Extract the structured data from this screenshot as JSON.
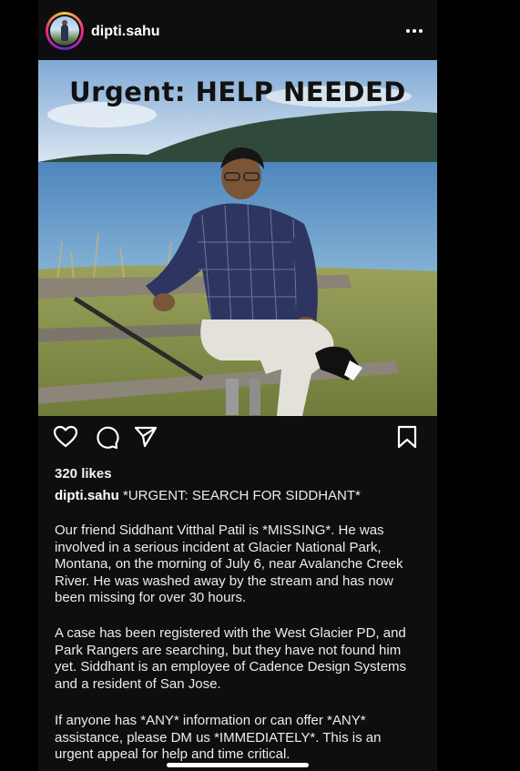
{
  "header": {
    "username": "dipti.sahu",
    "avatar_icon": "profile-avatar",
    "more_icon": "more-horizontal-icon"
  },
  "image": {
    "overlay_text": "Urgent: HELP NEEDED"
  },
  "actions": {
    "like_icon": "heart-icon",
    "comment_icon": "comment-icon",
    "share_icon": "send-icon",
    "save_icon": "bookmark-icon"
  },
  "likes": "320 likes",
  "caption": {
    "username": "dipti.sahu",
    "headline": "*URGENT: SEARCH FOR SIDDHANT*",
    "paragraphs": [
      "Our friend Siddhant Vitthal Patil is *MISSING*. He was involved in a serious incident at Glacier National Park, Montana, on the morning of July 6, near Avalanche Creek River. He was washed away by the stream and has now been missing for over 30 hours.",
      "A case has been registered with the West Glacier PD, and Park Rangers are searching, but they have not found him yet. Siddhant is an employee of Cadence Design Systems and a resident of San Jose.",
      "If anyone has *ANY* information or can offer *ANY* assistance, please DM us *IMMEDIATELY*. This is an urgent appeal for help and time critical."
    ]
  },
  "colors": {
    "background": "#000000",
    "post_background": "#0e0e10",
    "text": "#ececec"
  }
}
